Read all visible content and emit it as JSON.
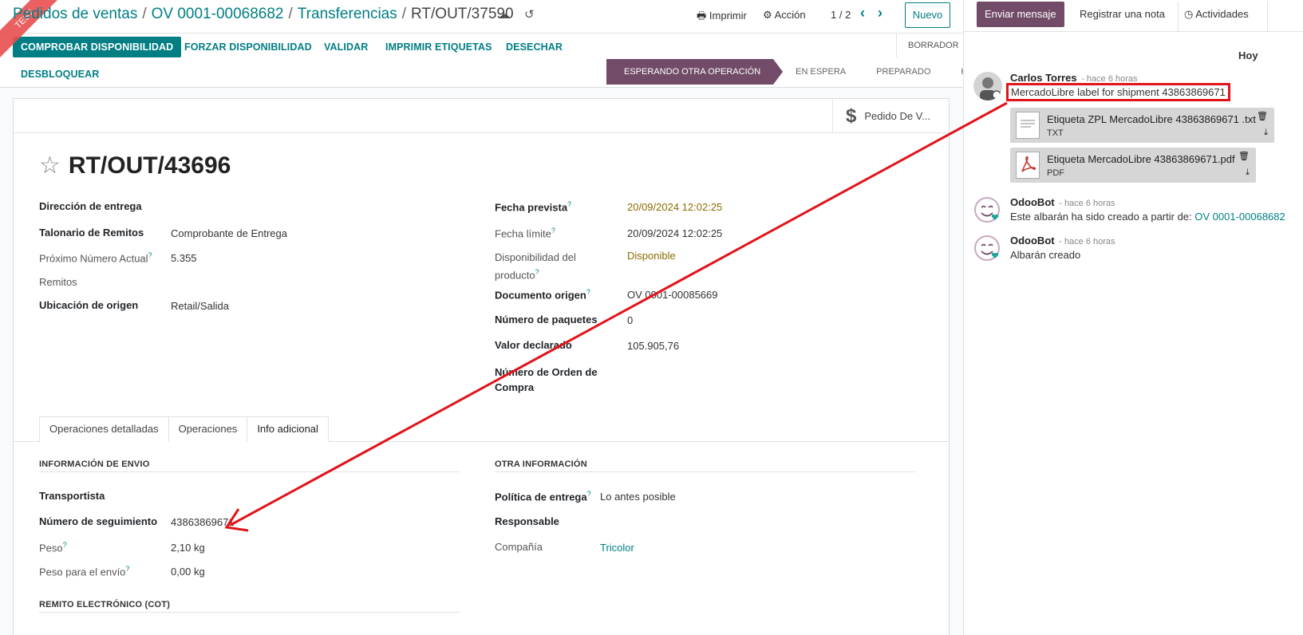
{
  "ribbon": "TEST",
  "breadcrumb": {
    "items": [
      "Pedidos de ventas",
      "OV 0001-00068682",
      "Transferencias"
    ],
    "current": "RT/OUT/37590"
  },
  "toolbar": {
    "print": "Imprimir",
    "action": "Acción",
    "pager": "1 / 2",
    "new": "Nuevo"
  },
  "actions": {
    "check_availability": "COMPROBAR DISPONIBILIDAD",
    "force_availability": "FORZAR DISPONIBILIDAD",
    "validate": "VALIDAR",
    "print_labels": "IMPRIMIR ETIQUETAS",
    "scrap": "DESECHAR",
    "unlock": "DESBLOQUEAR",
    "draft": "BORRADOR"
  },
  "stages": [
    "ESPERANDO OTRA OPERACIÓN",
    "EN ESPERA",
    "PREPARADO",
    "HECHO"
  ],
  "smart_button": "Pedido De V...",
  "record": {
    "name": "RT/OUT/43696",
    "left_fields": [
      {
        "label": "Dirección de entrega",
        "value": ""
      },
      {
        "label": "Talonario de Remitos",
        "value": "Comprobante de Entrega"
      },
      {
        "label": "Próximo Número Actual",
        "value": "5.355"
      },
      {
        "label": "Remitos",
        "value": ""
      },
      {
        "label": "Ubicación de origen",
        "value": "Retail/Salida"
      }
    ],
    "right_fields": [
      {
        "label": "Fecha prevista",
        "value": "20/09/2024 12:02:25"
      },
      {
        "label": "Fecha límite",
        "value": "20/09/2024 12:02:25"
      },
      {
        "label": "Disponibilidad del producto",
        "value": "Disponible"
      },
      {
        "label": "Documento origen",
        "value": "OV 0001-00085669"
      },
      {
        "label": "Número de paquetes",
        "value": "0"
      },
      {
        "label": "Valor declarado",
        "value": "105.905,76"
      },
      {
        "label": "Número de Orden de Compra",
        "value": ""
      }
    ]
  },
  "tabs": [
    "Operaciones detalladas",
    "Operaciones",
    "Info adicional"
  ],
  "shipping": {
    "title": "INFORMACIÓN DE ENVIO",
    "carrier_label": "Transportista",
    "tracking_label": "Número de seguimiento",
    "tracking_value": "43863869671",
    "weight_label": "Peso",
    "weight_value": "2,10",
    "shipping_weight_label": "Peso para el envío",
    "shipping_weight_value": "0,00",
    "unit": "kg"
  },
  "other": {
    "title": "OTRA INFORMACIÓN",
    "policy_label": "Política de entrega",
    "policy_value": "Lo antes posible",
    "responsible_label": "Responsable",
    "company_label": "Compañía",
    "company_value": "Tricolor"
  },
  "remito_title": "REMITO ELECTRÓNICO (COT)",
  "chatter": {
    "send": "Enviar mensaje",
    "note": "Registrar una nota",
    "activities": "Actividades",
    "today": "Hoy",
    "messages": [
      {
        "author": "Carlos Torres",
        "time": "- hace 6 horas",
        "body": "MercadoLibre label for shipment 43863869671"
      },
      {
        "author": "OdooBot",
        "time": "- hace 6 horas",
        "body": "Este albarán ha sido creado a partir de:",
        "link": "OV 0001-00068682"
      },
      {
        "author": "OdooBot",
        "time": "- hace 6 horas",
        "body": "Albarán creado"
      }
    ],
    "attachments": [
      {
        "name": "Etiqueta ZPL MercadoLibre 43863869671 .txt",
        "type": "TXT"
      },
      {
        "name": "Etiqueta MercadoLibre 43863869671.pdf",
        "type": "PDF"
      }
    ]
  },
  "colors": {
    "primary": "#017e84",
    "brand": "#714b67",
    "annotation": "#e0141a"
  }
}
